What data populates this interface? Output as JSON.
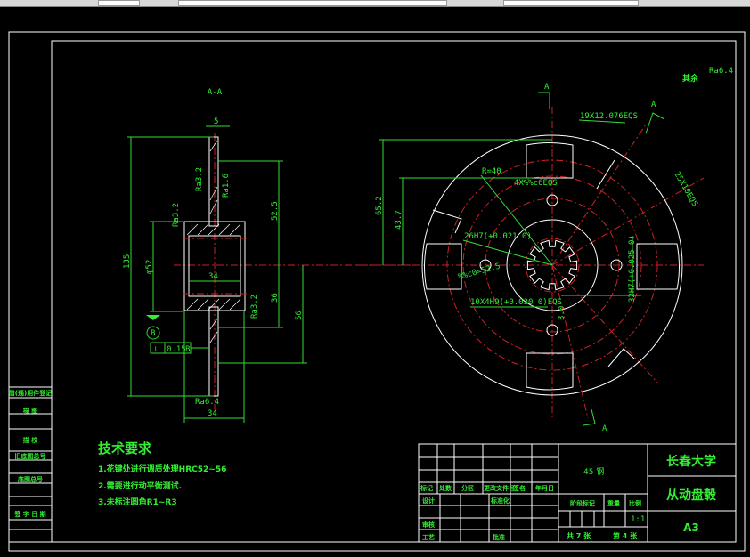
{
  "section_view": {
    "title": "A-A",
    "dims": {
      "width_top": "5",
      "overall_dia": "135",
      "hub_dia": "φ52",
      "r1": "52.5",
      "r2": "36",
      "r3": "56",
      "bore_len": "34",
      "hub_len": "34"
    },
    "roughness": [
      "Ra3.2",
      "Ra1.6",
      "Ra3.2",
      "Ra3.2",
      "Ra6.4"
    ],
    "datum": "B",
    "tolerance": {
      "symbol": "⊥",
      "value": "0.15",
      "datum": "B"
    }
  },
  "front_view": {
    "section_mark": "A",
    "other_roughness": "其余",
    "other_roughness_value": "Ra6.4",
    "dims": {
      "d652": "65.2",
      "d437": "43.7",
      "radius": "R=40",
      "holes": "4X%%c6EQS",
      "bore": "26H7(+0.021 0)",
      "slot1": "19X12.076EQS",
      "slot2": "25X10EQS",
      "spline": "10X4H9(+0.030 0)EQS",
      "key": "32H7(+0.025 0)",
      "pcd": "%%c0=52.5",
      "small": "3.0"
    }
  },
  "tech_requirements": {
    "title": "技术要求",
    "items": [
      "1.花键处进行调质处理HRC52~56",
      "2.需要进行动平衡测试.",
      "3.未标注圆角R1~R3"
    ]
  },
  "left_strip": [
    "借(通)用件登记",
    "描 图",
    "描 校",
    "旧底图总号",
    "底图总号",
    "签 字 日 期"
  ],
  "title_block": {
    "material": "45 钢",
    "school": "长春大学",
    "part_name": "从动盘毂",
    "sheet_size": "A3",
    "headers": [
      "标记",
      "处数",
      "分区",
      "更改文件号",
      "签名",
      "年月日"
    ],
    "design": "设计",
    "standardize": "标准化",
    "review": "审核",
    "process": "工艺",
    "approve": "批准",
    "stage_mark": "阶段标记",
    "weight": "重量",
    "scale_label": "比例",
    "scale": "1:1",
    "total_sheets": "共 7 张",
    "sheet_no": "第 4 张"
  }
}
